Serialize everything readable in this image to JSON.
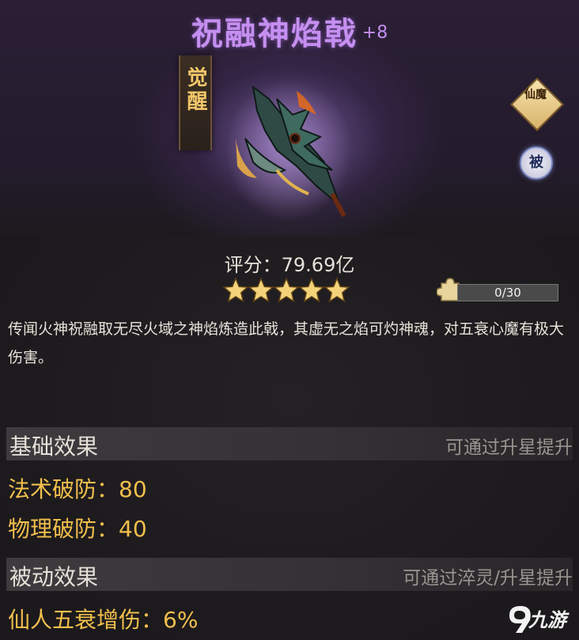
{
  "item": {
    "name": "祝融神焰戟",
    "enhance": "+8",
    "awaken_tag": "觉醒",
    "badges": {
      "type": "仙魔",
      "passive": "被"
    },
    "score_label": "评分：",
    "score_value": "79.69亿",
    "stars": 5,
    "fragments": {
      "text": "0/30",
      "current": 0,
      "total": 30
    },
    "description": "传闻火神祝融取无尽火域之神焰炼造此戟，其虚无之焰可灼神魂，对五衰心魔有极大伤害。"
  },
  "sections": {
    "base": {
      "title": "基础效果",
      "note": "可通过升星提升",
      "stats": [
        "法术破防：80",
        "物理破防：40"
      ]
    },
    "passive": {
      "title": "被动效果",
      "note": "可通过淬灵/升星提升",
      "stats": [
        "仙人五衰增伤：6%"
      ]
    }
  },
  "watermark": {
    "logo_text": "九游"
  },
  "colors": {
    "title": "#c58ff0",
    "stat": "#f1bf4c",
    "star": "#f3d27a"
  }
}
